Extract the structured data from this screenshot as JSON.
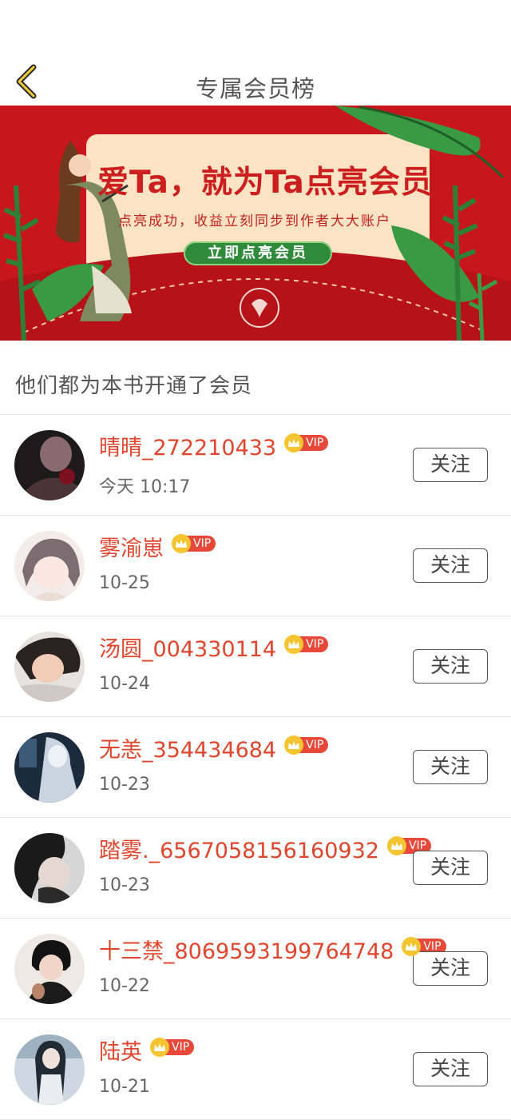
{
  "header": {
    "title": "专属会员榜"
  },
  "banner": {
    "headline": "爱Ta，就为Ta点亮会员",
    "subtitle": "点亮成功，收益立刻同步到作者大大账户",
    "cta": "立即点亮会员"
  },
  "section": {
    "title": "他们都为本书开通了会员"
  },
  "vip_label": "VIP",
  "follow_label": "关注",
  "members": [
    {
      "name": "晴晴_272210433",
      "time": "今天 10:17"
    },
    {
      "name": "雾渝崽",
      "time": "10-25"
    },
    {
      "name": "汤圆_004330114",
      "time": "10-24"
    },
    {
      "name": "无恙_354434684",
      "time": "10-23"
    },
    {
      "name": "踏雾._6567058156160932",
      "time": "10-23"
    },
    {
      "name": "十三禁_8069593199764748",
      "time": "10-22"
    },
    {
      "name": "陆英",
      "time": "10-21"
    }
  ],
  "colors": {
    "accent": "#e0462d",
    "banner_red": "#c8161d",
    "cta_green": "#2f8a3a",
    "vip_gold": "#f5c531"
  }
}
